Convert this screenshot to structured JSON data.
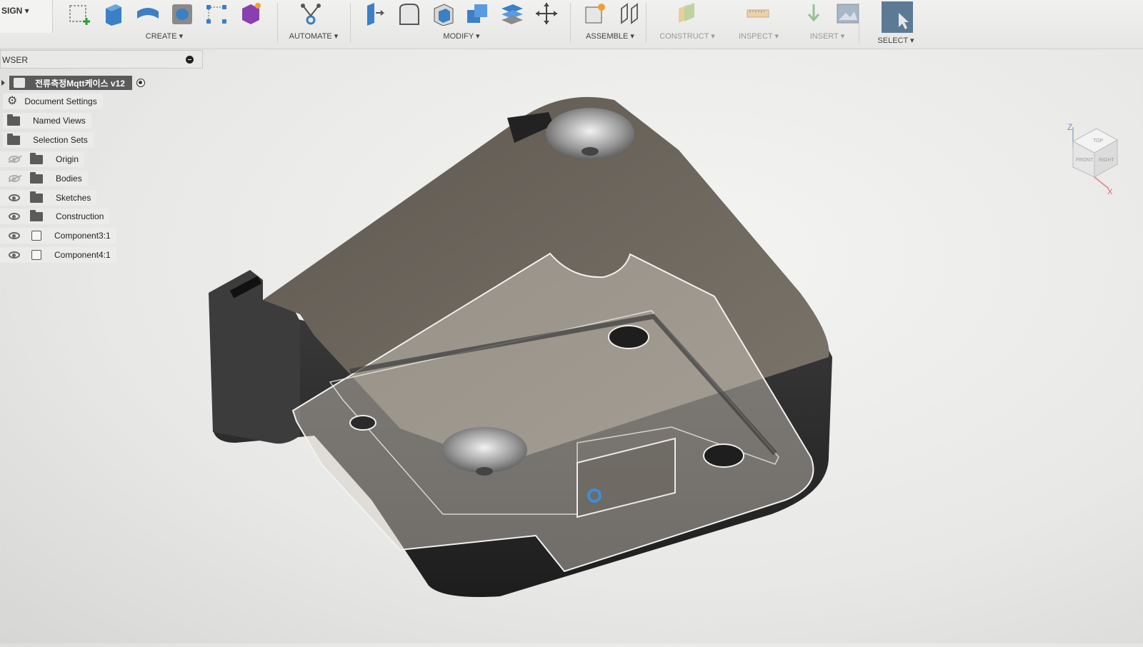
{
  "toolbar": {
    "workspace_label": "SIGN ▾",
    "groups": [
      {
        "label": "CREATE ▾"
      },
      {
        "label": "AUTOMATE ▾"
      },
      {
        "label": "MODIFY ▾"
      },
      {
        "label": "ASSEMBLE ▾"
      },
      {
        "label": "CONSTRUCT ▾"
      },
      {
        "label": "INSPECT ▾"
      },
      {
        "label": "INSERT ▾"
      },
      {
        "label": "SELECT ▾"
      }
    ]
  },
  "browser": {
    "header": "WSER",
    "root": {
      "label": "전류측정Mqtt케이스 v12"
    },
    "items": [
      {
        "label": "Document Settings",
        "icon": "gear-icon"
      },
      {
        "label": "Named Views",
        "icon": "folder-icon"
      },
      {
        "label": "Selection Sets",
        "icon": "folder-icon"
      },
      {
        "label": "Origin",
        "icon": "folder-icon",
        "visible": false
      },
      {
        "label": "Bodies",
        "icon": "folder-icon",
        "visible": false
      },
      {
        "label": "Sketches",
        "icon": "folder-icon",
        "visible": true
      },
      {
        "label": "Construction",
        "icon": "folder-icon",
        "visible": true
      },
      {
        "label": "Component3:1",
        "icon": "component-icon",
        "visible": true
      },
      {
        "label": "Component4:1",
        "icon": "component-icon",
        "visible": true
      }
    ]
  },
  "viewcube": {
    "top": "TOP",
    "front": "FRONT",
    "right": "RIGHT",
    "axis_z": "Z",
    "axis_x": "X"
  },
  "colors": {
    "model_body": "#6e6860",
    "model_side": "#2f2f2f",
    "translucent_part": "#c9c4bd",
    "accent_selected": "#3a8fd8"
  }
}
